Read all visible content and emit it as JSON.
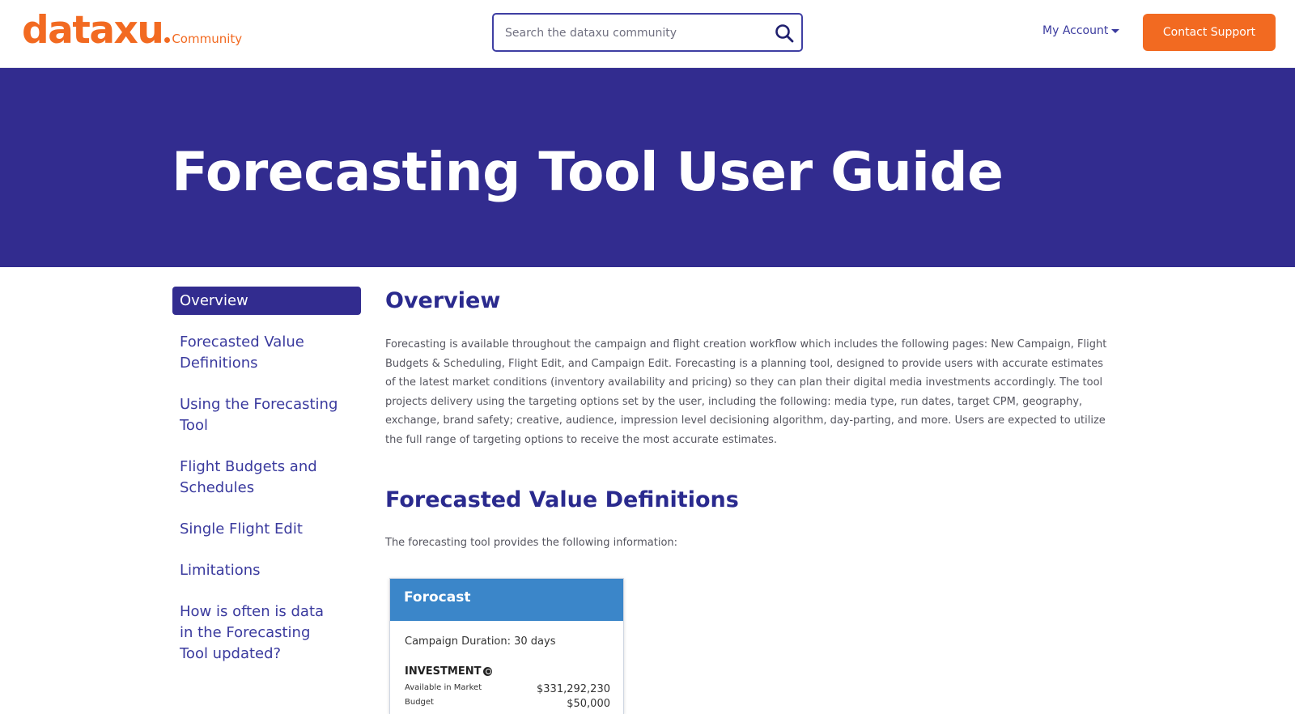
{
  "header": {
    "logo_word": "dataxu",
    "logo_sub": "Community",
    "search_placeholder": "Search the dataxu community",
    "my_account_label": "My Account",
    "contact_button_label": "Contact Support"
  },
  "hero": {
    "title": "Forecasting Tool User Guide"
  },
  "sidebar": {
    "items": [
      {
        "label": "Overview",
        "active": true
      },
      {
        "label": "Forecasted Value Definitions"
      },
      {
        "label": "Using the Forecasting Tool"
      },
      {
        "label": "Flight Budgets and Schedules"
      },
      {
        "label": "Single Flight Edit"
      },
      {
        "label": "Limitations"
      },
      {
        "label": "How is often is data in the Forecasting Tool updated?"
      }
    ]
  },
  "main": {
    "overview_heading": "Overview",
    "overview_text": "Forecasting is available throughout the campaign and flight creation workflow which includes the following pages: New Campaign, Flight Budgets & Scheduling, Flight Edit, and Campaign Edit. Forecasting is a planning tool, designed to provide users with accurate estimates of the latest market conditions (inventory availability and pricing) so they can plan their digital media investments accordingly. The tool projects delivery using the targeting options set by the user, including the following: media type, run dates, target CPM, geography, exchange, brand safety; creative, audience, impression level decisioning algorithm, day-parting, and more. Users are expected to utilize the full range of targeting options to receive the most accurate estimates.",
    "definitions_heading": "Forecasted Value Definitions",
    "definitions_text": "The forecasting tool provides the following information:"
  },
  "forecast_card": {
    "title": "Forocast",
    "duration": "Campaign Duration: 30 days",
    "investment_label": "INVESTMENT",
    "rows": [
      {
        "label": "Available in Market",
        "value": "$331,292,230"
      },
      {
        "label": "Budget",
        "value": "$50,000"
      }
    ]
  },
  "colors": {
    "brand_orange": "#f26a21",
    "brand_indigo": "#322c8f",
    "link_blue": "#3a3a9e",
    "card_header_blue": "#3b86c9"
  }
}
